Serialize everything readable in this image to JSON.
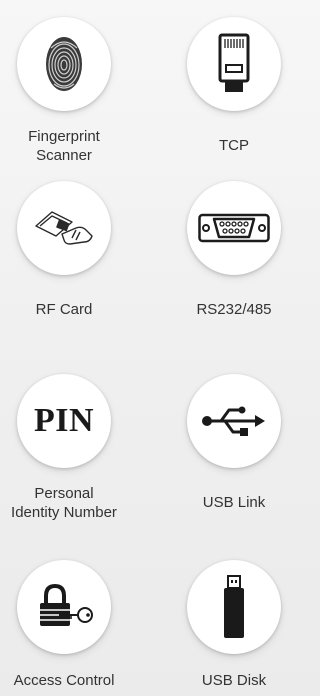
{
  "features": [
    {
      "key": "fingerprint",
      "icon": "fingerprint-icon",
      "label_lines": [
        "Fingerprint",
        "Scanner"
      ]
    },
    {
      "key": "tcp",
      "icon": "ethernet-rj45-icon",
      "label_lines": [
        "TCP"
      ]
    },
    {
      "key": "rf_card",
      "icon": "rf-card-tap-icon",
      "label_lines": [
        "RF Card"
      ]
    },
    {
      "key": "rs232",
      "icon": "serial-db9-port-icon",
      "label_lines": [
        "RS232/485"
      ]
    },
    {
      "key": "pin",
      "icon": "pin-text-icon",
      "icon_text": "PIN",
      "label_lines": [
        "Personal",
        "Identity Number"
      ]
    },
    {
      "key": "usb_link",
      "icon": "usb-symbol-icon",
      "label_lines": [
        "USB Link"
      ]
    },
    {
      "key": "access_control",
      "icon": "lock-and-key-icon",
      "label_lines": [
        "Access Control"
      ]
    },
    {
      "key": "usb_disk",
      "icon": "usb-flash-drive-icon",
      "label_lines": [
        "USB Disk"
      ]
    }
  ]
}
